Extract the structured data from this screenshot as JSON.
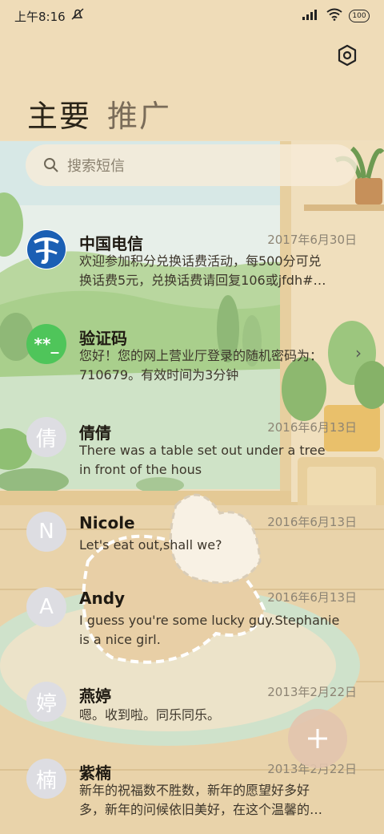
{
  "status_bar": {
    "time": "上午8:16",
    "battery": "100",
    "icons": [
      "mute-icon",
      "signal-icon",
      "wifi-icon",
      "battery-icon"
    ]
  },
  "tabs": [
    {
      "label": "主要",
      "active": true
    },
    {
      "label": "推广",
      "active": false
    }
  ],
  "search": {
    "placeholder": "搜索短信",
    "icon": "search-icon"
  },
  "settings": {
    "icon": "settings-icon"
  },
  "messages": [
    {
      "sender": "中国电信",
      "date": "2017年6月30日",
      "preview_lines": [
        "欢迎参加积分兑换话费活动，每500分可兑",
        "换话费5元，兑换话费请回复106或jfdh#…"
      ],
      "avatar": {
        "type": "logo",
        "icon": "china-telecom-logo"
      }
    },
    {
      "sender": "验证码",
      "date": "",
      "preview_lines": [
        "您好！您的网上营业厅登录的随机密码为：",
        "710679。有效时间为3分钟"
      ],
      "avatar": {
        "type": "code",
        "text": "**_"
      }
    },
    {
      "sender": "倩倩",
      "date": "2016年6月13日",
      "preview_lines": [
        "There was a table set out under a tree",
        "in front of the hous"
      ],
      "avatar": {
        "type": "letter",
        "text": "倩"
      }
    },
    {
      "sender": "Nicole",
      "date": "2016年6月13日",
      "preview_lines": [
        "Let's eat out,shall we?"
      ],
      "avatar": {
        "type": "letter",
        "text": "N"
      }
    },
    {
      "sender": "Andy",
      "date": "2016年6月13日",
      "preview_lines": [
        "I guess you're some lucky guy.Stephanie",
        "is a nice girl."
      ],
      "avatar": {
        "type": "letter",
        "text": "A"
      }
    },
    {
      "sender": "燕婷",
      "date": "2013年2月22日",
      "preview_lines": [
        "嗯。收到啦。同乐同乐。"
      ],
      "avatar": {
        "type": "letter",
        "text": "婷"
      }
    },
    {
      "sender": "紫楠",
      "date": "2013年2月22日",
      "preview_lines": [
        "新年的祝福数不胜数，新年的愿望好多好",
        "多，新年的问候依旧美好，在这个温馨的…"
      ],
      "avatar": {
        "type": "letter",
        "text": "楠"
      }
    }
  ],
  "fab": {
    "icon": "plus-icon"
  },
  "colors": {
    "background": "#efdfbf",
    "green_avatar": "#4fc55a",
    "telecom_blue": "#1b5fb4"
  }
}
